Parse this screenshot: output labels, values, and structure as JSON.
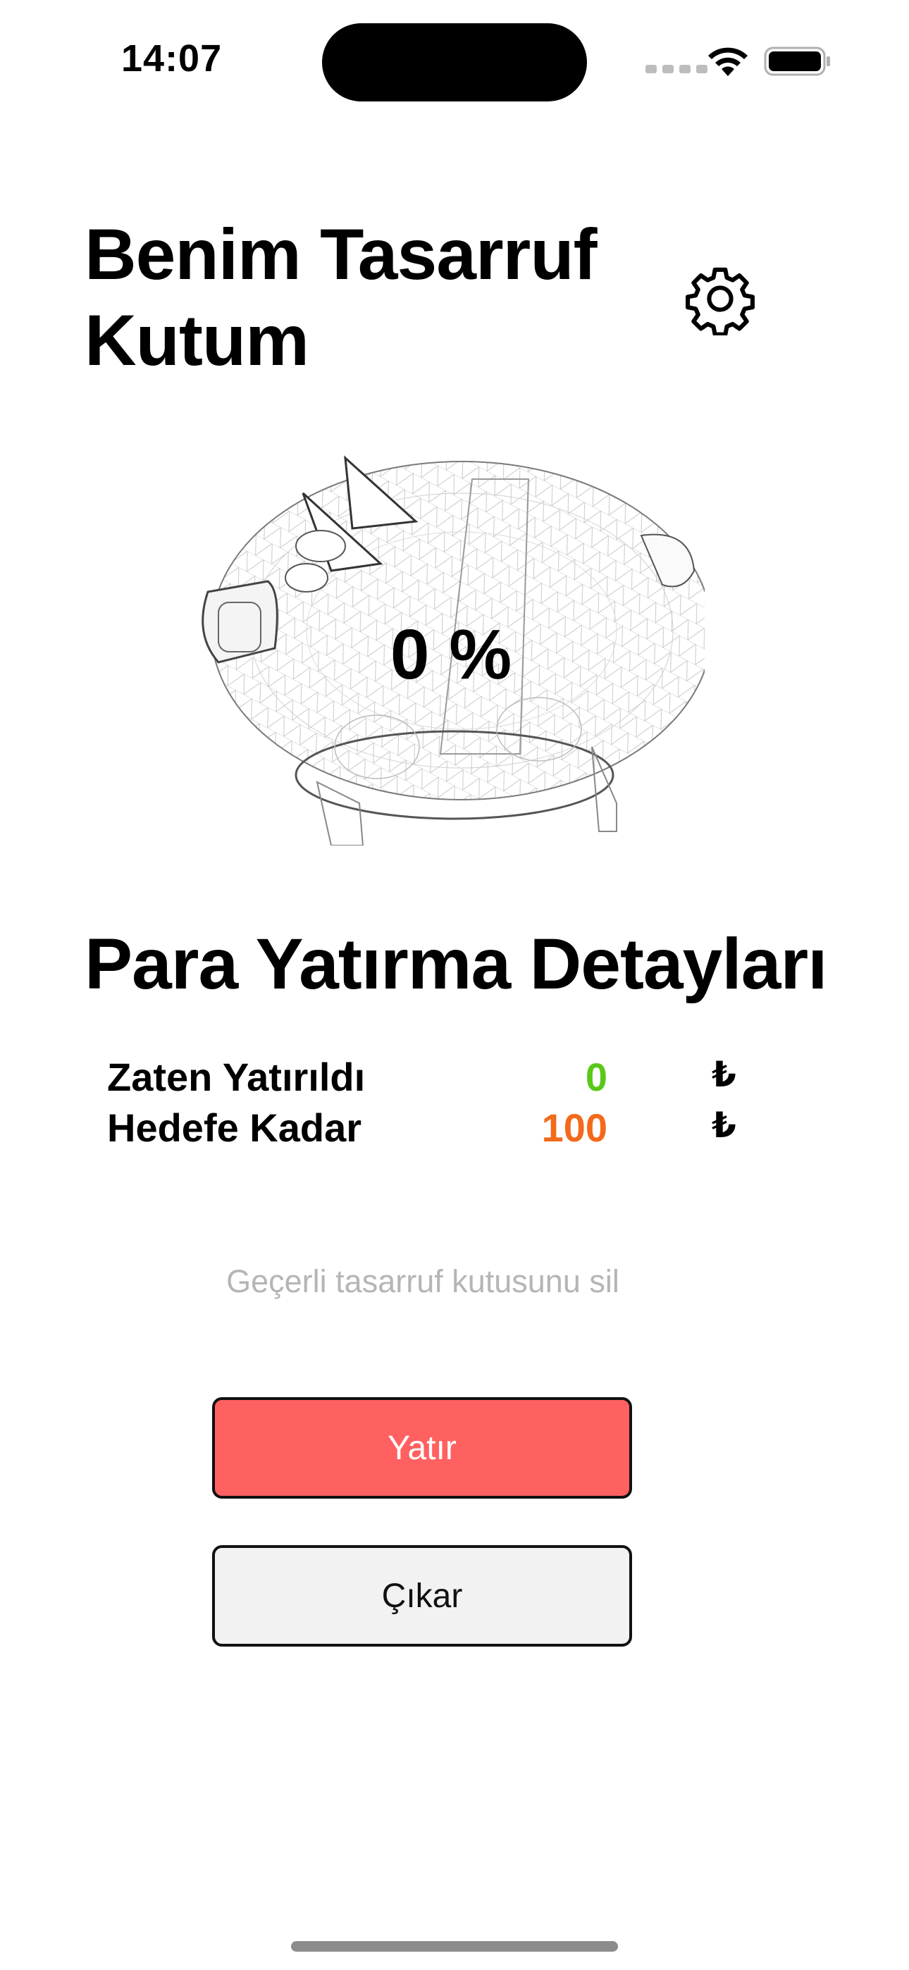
{
  "status_bar": {
    "time": "14:07"
  },
  "header": {
    "title": "Benim Tasarruf Kutum",
    "settings_icon": "gear-icon"
  },
  "progress": {
    "label": "0 %",
    "value_percent": 0
  },
  "details": {
    "title": "Para Yatırma Detayları",
    "rows": [
      {
        "label": "Zaten Yatırıldı",
        "value": "0",
        "currency": "₺",
        "color": "#5ac818"
      },
      {
        "label": "Hedefe Kadar",
        "value": "100",
        "currency": "₺",
        "color": "#f26a1b"
      }
    ]
  },
  "actions": {
    "delete_label": "Geçerli tasarruf kutusunu sil",
    "deposit_label": "Yatır",
    "withdraw_label": "Çıkar"
  },
  "colors": {
    "deposit_button": "#ff6161",
    "withdraw_button": "#f2f2f2",
    "muted_text": "#b5b5b5"
  }
}
